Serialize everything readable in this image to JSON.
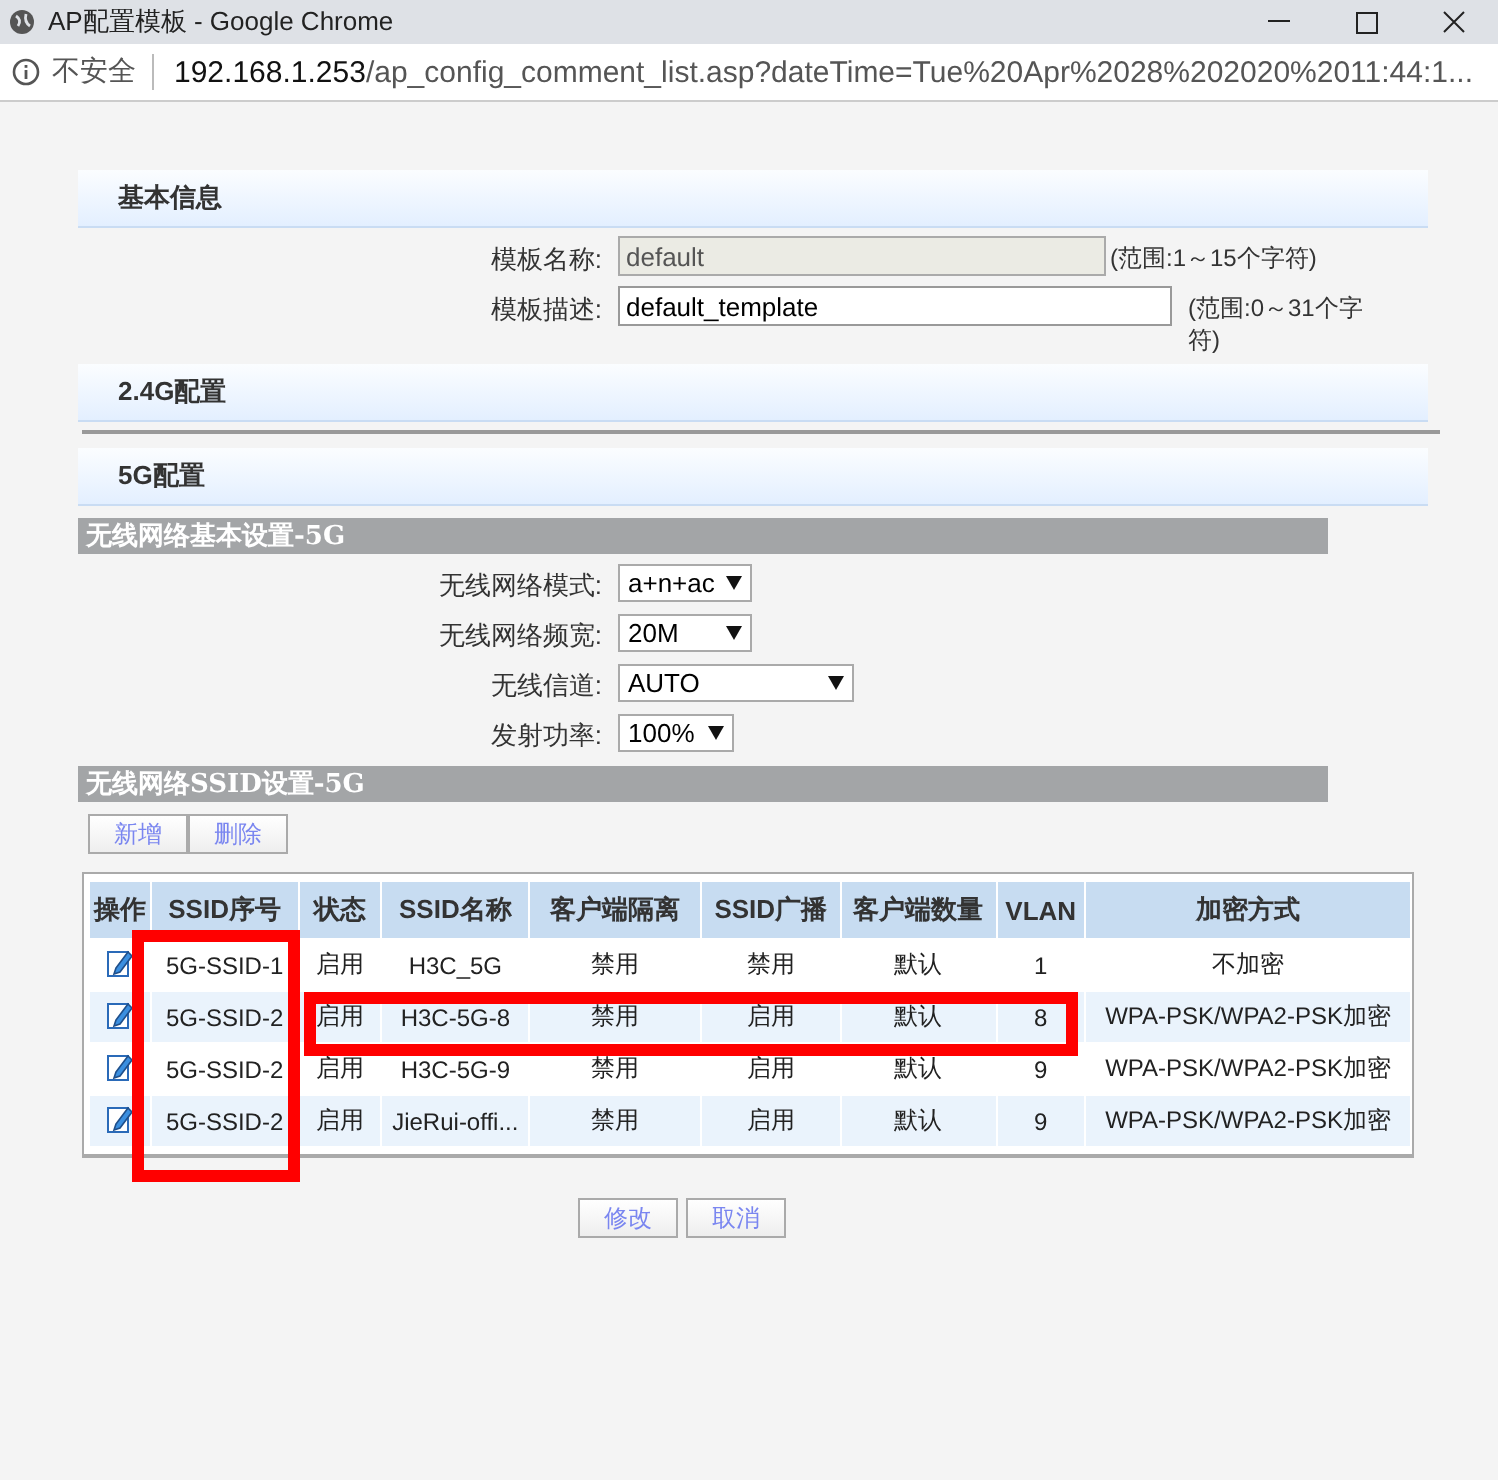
{
  "window": {
    "title": "AP配置模板 - Google Chrome"
  },
  "address_bar": {
    "security": "不安全",
    "host": "192.168.1.253",
    "path": "/ap_config_comment_list.asp?dateTime=Tue%20Apr%2028%202020%2011:44:1..."
  },
  "basic_info": {
    "title": "基本信息",
    "fields": [
      {
        "label": "模板名称:",
        "value": "default",
        "disabled": true,
        "hint": "(范围:1～15个字符)"
      },
      {
        "label": "模板描述:",
        "value": "default_template",
        "disabled": false,
        "hint": "(范围:0～31个字符)"
      }
    ]
  },
  "section_24g": {
    "title": "2.4G配置"
  },
  "section_5g": {
    "title": "5G配置"
  },
  "wireless_basic": {
    "title": "无线网络基本设置-5G",
    "selects": [
      {
        "label": "无线网络模式:",
        "value": "a+n+ac"
      },
      {
        "label": "无线网络频宽:",
        "value": "20M"
      },
      {
        "label": "无线信道:",
        "value": "AUTO"
      },
      {
        "label": "发射功率:",
        "value": "100%"
      }
    ]
  },
  "ssid_settings": {
    "title": "无线网络SSID设置-5G",
    "buttons": [
      "新增",
      "删除"
    ]
  },
  "table": {
    "columns": [
      "操作",
      "SSID序号",
      "状态",
      "SSID名称",
      "客户端隔离",
      "SSID广播",
      "客户端数量",
      "VLAN",
      "加密方式"
    ],
    "rows": [
      [
        "",
        "5G-SSID-1",
        "启用",
        "H3C_5G",
        "禁用",
        "禁用",
        "默认",
        "1",
        "不加密"
      ],
      [
        "",
        "5G-SSID-2",
        "启用",
        "H3C-5G-8",
        "禁用",
        "启用",
        "默认",
        "8",
        "WPA-PSK/WPA2-PSK加密"
      ],
      [
        "",
        "5G-SSID-2",
        "启用",
        "H3C-5G-9",
        "禁用",
        "启用",
        "默认",
        "9",
        "WPA-PSK/WPA2-PSK加密"
      ],
      [
        "",
        "5G-SSID-2",
        "启用",
        "JieRui-offi...",
        "禁用",
        "启用",
        "默认",
        "9",
        "WPA-PSK/WPA2-PSK加密"
      ]
    ]
  },
  "footer_buttons": [
    "修改",
    "取消"
  ]
}
